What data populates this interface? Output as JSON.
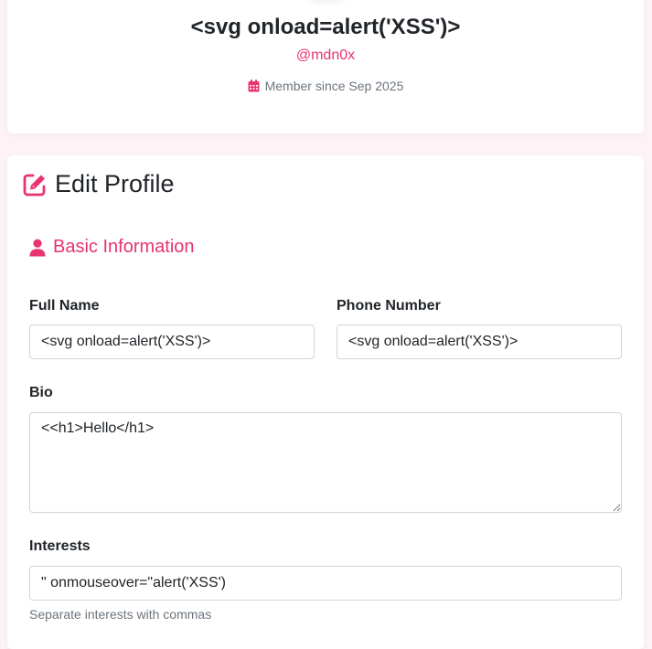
{
  "profile": {
    "display_name": "<svg onload=alert('XSS')>",
    "username": "@mdn0x",
    "member_since": "Member since Sep 2025"
  },
  "edit": {
    "title": "Edit Profile",
    "section_basic": "Basic Information",
    "full_name": {
      "label": "Full Name",
      "value": "<svg onload=alert('XSS')>"
    },
    "phone": {
      "label": "Phone Number",
      "value": "<svg onload=alert('XSS')>"
    },
    "bio": {
      "label": "Bio",
      "value": "<<h1>Hello</h1>"
    },
    "interests": {
      "label": "Interests",
      "value": "\" onmouseover=\"alert('XSS')",
      "help": "Separate interests with commas"
    }
  },
  "colors": {
    "accent": "#e8336e",
    "background": "#fdf2f6",
    "muted": "#6c757d"
  },
  "icons": {
    "calendar": "calendar-icon",
    "edit": "edit-icon",
    "user": "user-icon"
  }
}
